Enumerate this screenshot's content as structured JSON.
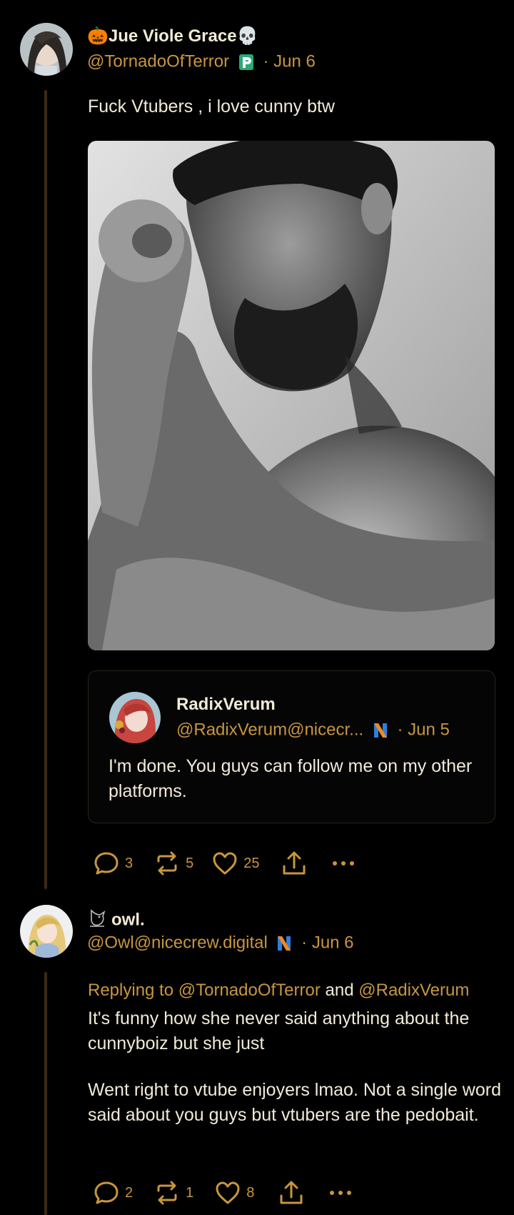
{
  "post": {
    "display_name": "Jue Viole Grace",
    "handle": "@TornadoOfTerror",
    "date": "· Jun 6",
    "text": "Fuck Vtubers , i love cunny btw",
    "quote": {
      "display_name": "RadixVerum",
      "handle": "@RadixVerum@nicecr...",
      "date": "· Jun 5",
      "text": "I'm done. You guys can follow me on my other platforms."
    },
    "stats": {
      "replies": "3",
      "reposts": "5",
      "likes": "25"
    }
  },
  "reply": {
    "display_name": "owl.",
    "handle": "@Owl@nicecrew.digital",
    "date": "· Jun 6",
    "replying_prefix": "Replying to",
    "replying_to_1": "@TornadoOfTerror",
    "replying_and": "and",
    "replying_to_2": "@RadixVerum",
    "paragraph_1": "It's funny how she never said anything about the cunnyboiz but she just",
    "paragraph_2": "Went right to vtube enjoyers lmao. Not a single word said about you guys but vtubers are the pedobait.",
    "stats": {
      "replies": "2",
      "reposts": "1",
      "likes": "8"
    }
  },
  "colors": {
    "accent": "#c8963e",
    "text": "#f2ead8",
    "background": "#000000",
    "thread_line": "#3b2a12"
  }
}
